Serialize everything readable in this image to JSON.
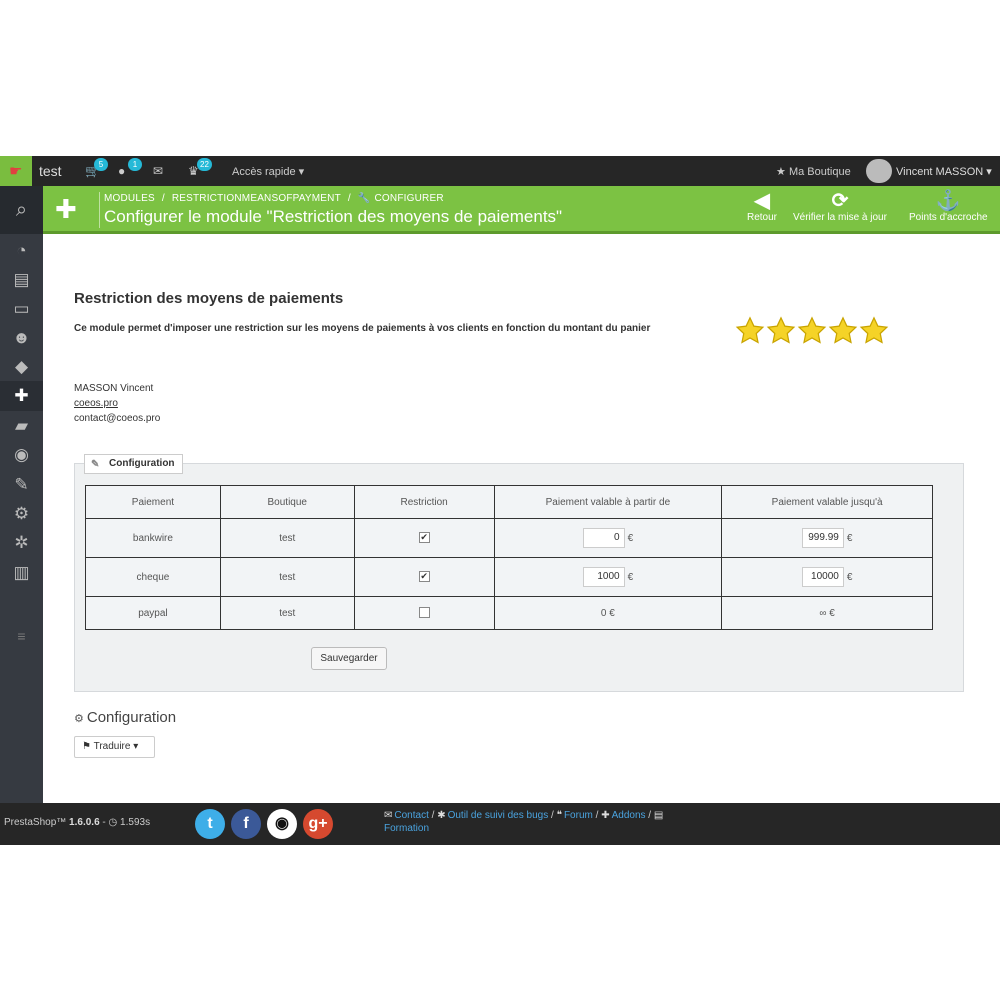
{
  "topbar": {
    "shop_name": "test",
    "orders_badge": "5",
    "customers_badge": "1",
    "messages_badge": "22",
    "quick_access": "Accès rapide",
    "my_shop": "Ma Boutique",
    "user_name": "Vincent MASSON"
  },
  "header": {
    "breadcrumb": [
      "MODULES",
      "/",
      "RESTRICTIONMEANSOFPAYMENT",
      "/",
      "CONFIGURER"
    ],
    "title": "Configurer le module \"Restriction des moyens de paiements\"",
    "toolbar": {
      "back": "Retour",
      "check_update": "Vérifier la mise à jour",
      "hooks": "Points d'accroche"
    }
  },
  "module": {
    "title": "Restriction des moyens de paiements",
    "description": "Ce module permet d'imposer une restriction sur les moyens de paiements à vos clients en fonction du montant du panier",
    "rating": 5,
    "author_name": "MASSON Vincent",
    "author_site": "coeos.pro",
    "author_email": "contact@coeos.pro"
  },
  "config_panel": {
    "legend": "Configuration",
    "columns": [
      "Paiement",
      "Boutique",
      "Restriction",
      "Paiement valable à partir de",
      "Paiement valable jusqu'à"
    ],
    "rows": [
      {
        "payment": "bankwire",
        "shop": "test",
        "restriction": true,
        "from": "0",
        "to": "999.99",
        "currency": "€"
      },
      {
        "payment": "cheque",
        "shop": "test",
        "restriction": true,
        "from": "1000",
        "to": "10000",
        "currency": "€"
      },
      {
        "payment": "paypal",
        "shop": "test",
        "restriction": false,
        "from": "0 €",
        "to": "∞ €"
      }
    ],
    "save_label": "Sauvegarder"
  },
  "config_section": {
    "title": "Configuration",
    "translate_label": "Traduire"
  },
  "footer": {
    "brand": "PrestaShop™",
    "version": "1.6.0.6",
    "time": "1.593s",
    "links": [
      "Contact",
      "Outil de suivi des bugs",
      "Forum",
      "Addons",
      "Formation"
    ]
  },
  "colors": {
    "accent_green": "#7cc243",
    "topbar": "#262626",
    "sidebar": "#363a41",
    "badge": "#25b9d7",
    "link": "#4aa3df"
  }
}
